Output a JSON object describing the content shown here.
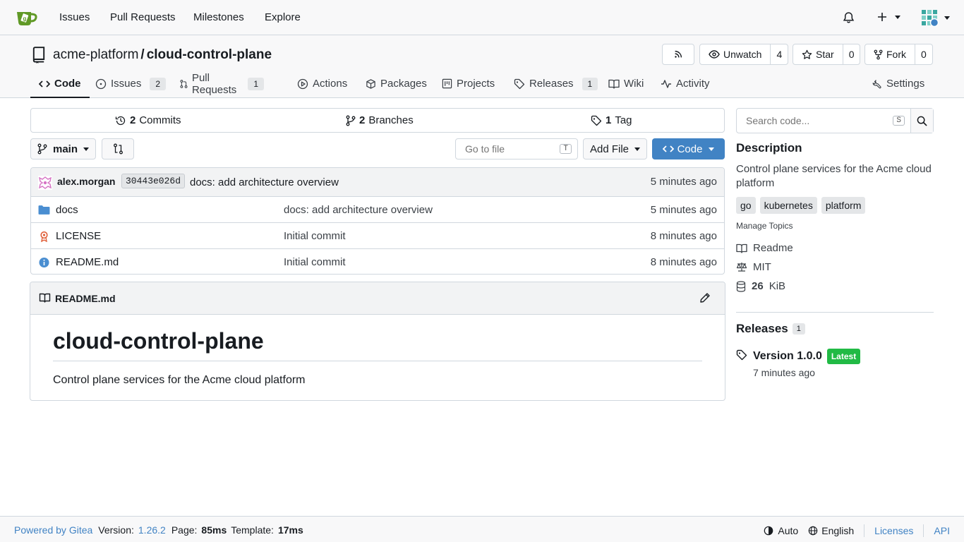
{
  "nav": {
    "links": [
      "Issues",
      "Pull Requests",
      "Milestones",
      "Explore"
    ],
    "icons": [
      "gitea-logo-icon",
      "bell-icon",
      "plus-icon",
      "avatar"
    ]
  },
  "repo": {
    "owner": "acme-platform",
    "separator": "/",
    "name": "cloud-control-plane",
    "watch_label": "Unwatch",
    "watch_count": "4",
    "star_label": "Star",
    "star_count": "0",
    "fork_label": "Fork",
    "fork_count": "0"
  },
  "tabs": {
    "code": "Code",
    "issues": "Issues",
    "issues_count": "2",
    "pulls": "Pull Requests",
    "pulls_count": "1",
    "actions": "Actions",
    "packages": "Packages",
    "projects": "Projects",
    "releases": "Releases",
    "releases_count": "1",
    "wiki": "Wiki",
    "activity": "Activity",
    "settings": "Settings"
  },
  "stats": {
    "commits_num": "2",
    "commits_label": "Commits",
    "branches_num": "2",
    "branches_label": "Branches",
    "tags_num": "1",
    "tags_label": "Tag"
  },
  "toolbar": {
    "branch": "main",
    "goto_placeholder": "Go to file",
    "goto_key": "T",
    "add_file": "Add File",
    "code": "Code"
  },
  "latest_commit": {
    "author": "alex.morgan",
    "sha": "30443e026d",
    "message": "docs: add architecture overview",
    "time": "5 minutes ago"
  },
  "files": [
    {
      "name": "docs",
      "message": "docs: add architecture overview",
      "time": "5 minutes ago",
      "icon": "folder-icon"
    },
    {
      "name": "LICENSE",
      "message": "Initial commit",
      "time": "8 minutes ago",
      "icon": "license-icon"
    },
    {
      "name": "README.md",
      "message": "Initial commit",
      "time": "8 minutes ago",
      "icon": "info-icon"
    }
  ],
  "readme": {
    "filename": "README.md",
    "heading": "cloud-control-plane",
    "body": "Control plane services for the Acme cloud platform"
  },
  "sidebar": {
    "search_placeholder": "Search code...",
    "search_key": "S",
    "description_title": "Description",
    "description": "Control plane services for the Acme cloud platform",
    "topics": [
      "go",
      "kubernetes",
      "platform"
    ],
    "manage_topics": "Manage Topics",
    "readme": "Readme",
    "license": "MIT",
    "size_num": "26",
    "size_unit": "KiB",
    "releases_title": "Releases",
    "releases_count": "1",
    "release_name": "Version 1.0.0",
    "release_badge": "Latest",
    "release_time": "7 minutes ago"
  },
  "footer": {
    "powered": "Powered by Gitea",
    "version_label": "Version:",
    "version": "1.26.2",
    "page_label": "Page:",
    "page_time": "85ms",
    "template_label": "Template:",
    "template_time": "17ms",
    "theme": "Auto",
    "language": "English",
    "licenses": "Licenses",
    "api": "API"
  },
  "colors": {
    "accent": "#4183c4",
    "latest_badge": "#21ba45",
    "gitea_green": "#609926"
  }
}
